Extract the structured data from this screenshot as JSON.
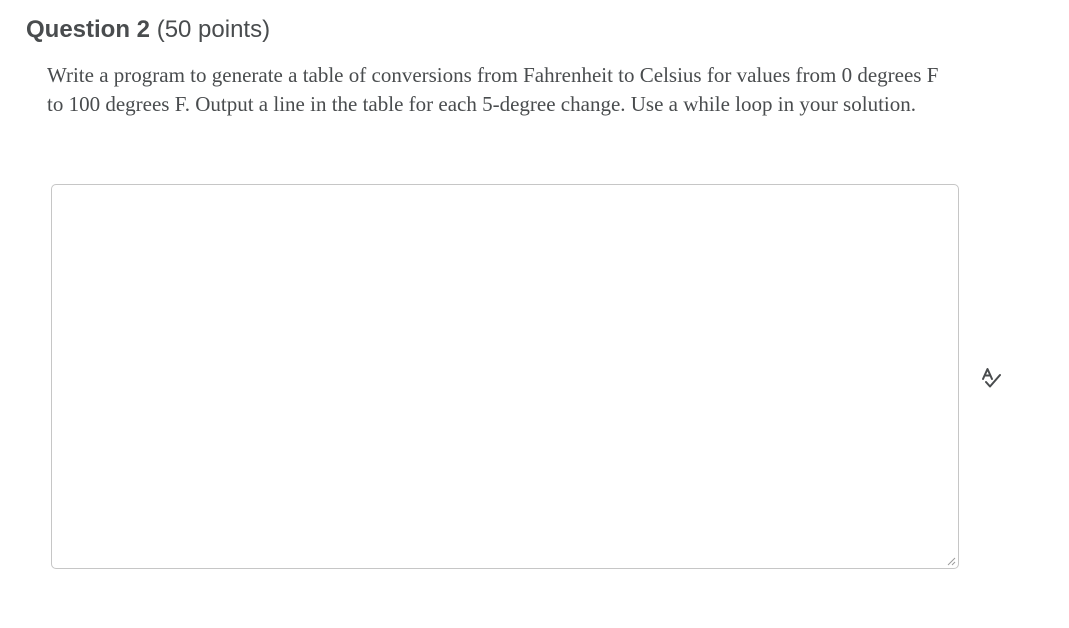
{
  "question": {
    "title": "Question 2",
    "points": "(50 points)",
    "prompt": "Write a program to generate a table of conversions from Fahrenheit to Celsius for values from 0 degrees F to 100 degrees F. Output a line in the table for each 5-degree change. Use a while loop in your solution."
  },
  "answer": {
    "value": "",
    "placeholder": ""
  },
  "icons": {
    "spellcheck": "spellcheck-icon",
    "resize": "resize-handle-icon"
  },
  "colors": {
    "text": "#494c4e",
    "border": "#c6c6c6",
    "icon": "#494c4e"
  }
}
